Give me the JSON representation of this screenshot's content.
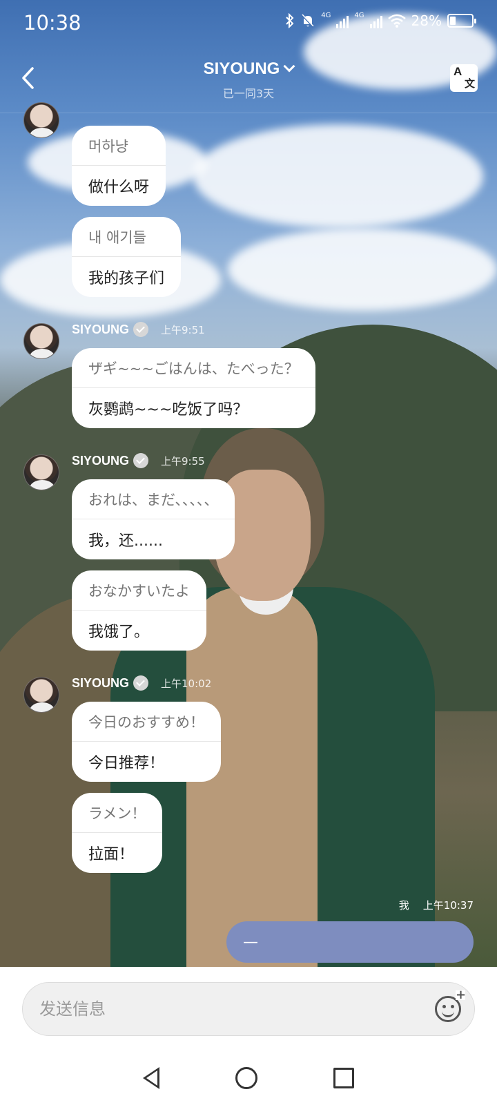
{
  "status_bar": {
    "time": "10:38",
    "network_1": "4G",
    "network_2": "4G",
    "battery_text": "28%",
    "battery_level": 0.28,
    "icons": [
      "bluetooth-icon",
      "bell-muted-icon",
      "signal-icon",
      "signal-icon",
      "wifi-icon",
      "battery-icon"
    ]
  },
  "header": {
    "title": "SIYOUNG",
    "subtitle": "已一同3天",
    "back_icon": "chevron-left-icon",
    "dropdown_icon": "chevron-down-icon",
    "translate_icon": "translate-icon",
    "translate_glyph_a": "A",
    "translate_glyph_b": "文"
  },
  "messages": [
    {
      "bubbles": [
        {
          "original": "머하냥",
          "translation": "做什么呀"
        },
        {
          "original": "내 애기들",
          "translation": "我的孩子们"
        }
      ]
    },
    {
      "sender": "SIYOUNG",
      "time": "上午9:51",
      "bubbles": [
        {
          "original": "ザギ~~~ごはんは、たべった？",
          "translation": "灰鹦鹉~~~吃饭了吗？"
        }
      ]
    },
    {
      "sender": "SIYOUNG",
      "time": "上午9:55",
      "bubbles": [
        {
          "original": "おれは、まだ、、、、、",
          "translation": "我，还......"
        },
        {
          "original": "おなかすいたよ",
          "translation": "我饿了。"
        }
      ]
    },
    {
      "sender": "SIYOUNG",
      "time": "上午10:02",
      "bubbles": [
        {
          "original": "今日のおすすめ！",
          "translation": "今日推荐！"
        },
        {
          "original": "ラメン！",
          "translation": "拉面！"
        }
      ]
    }
  ],
  "my_message": {
    "sender": "我",
    "time": "上午10:37",
    "text": "—"
  },
  "composer": {
    "placeholder": "发送信息",
    "emoji_icon": "emoji-add-icon"
  },
  "navbar": {
    "icons": [
      "nav-back-icon",
      "nav-home-icon",
      "nav-recents-icon"
    ]
  }
}
